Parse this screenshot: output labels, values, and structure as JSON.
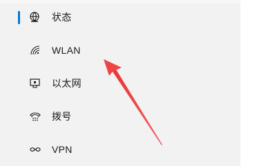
{
  "nav": {
    "items": [
      {
        "label": "状态",
        "icon": "status-globe-icon",
        "selected": true
      },
      {
        "label": "WLAN",
        "icon": "wifi-icon",
        "selected": false
      },
      {
        "label": "以太网",
        "icon": "ethernet-monitor-icon",
        "selected": false
      },
      {
        "label": "拨号",
        "icon": "dialup-phone-icon",
        "selected": false
      },
      {
        "label": "VPN",
        "icon": "vpn-icon",
        "selected": false
      }
    ]
  },
  "colors": {
    "accent": "#0078d7",
    "annotation_arrow": "#f04040",
    "nav_background": "#f2f2f2",
    "text": "#1a1a1a"
  }
}
